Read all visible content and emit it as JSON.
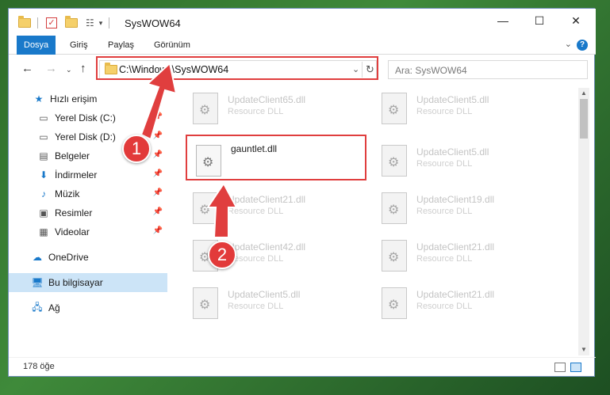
{
  "window": {
    "title": "SysWOW64",
    "minimize_glyph": "—",
    "maximize_glyph": "☐",
    "close_glyph": "✕"
  },
  "ribbon": {
    "tabs": [
      "Dosya",
      "Giriş",
      "Paylaş",
      "Görünüm"
    ],
    "help_glyph": "?"
  },
  "address": {
    "path": "C:\\Windows\\SysWOW64",
    "search_placeholder": "Ara: SysWOW64"
  },
  "sidebar": {
    "items": [
      {
        "label": "Hızlı erişim",
        "icon": "star-icon",
        "pinned": false
      },
      {
        "label": "Yerel Disk (C:)",
        "icon": "drive-icon",
        "pinned": true
      },
      {
        "label": "Yerel Disk (D:)",
        "icon": "drive-icon",
        "pinned": true
      },
      {
        "label": "Belgeler",
        "icon": "document-icon",
        "pinned": true
      },
      {
        "label": "İndirmeler",
        "icon": "download-icon",
        "pinned": true
      },
      {
        "label": "Müzik",
        "icon": "music-icon",
        "pinned": true
      },
      {
        "label": "Resimler",
        "icon": "picture-icon",
        "pinned": true
      },
      {
        "label": "Videolar",
        "icon": "video-icon",
        "pinned": true
      },
      {
        "label": "OneDrive",
        "icon": "cloud-icon",
        "pinned": false
      },
      {
        "label": "Bu bilgisayar",
        "icon": "computer-icon",
        "pinned": false
      },
      {
        "label": "Ağ",
        "icon": "network-icon",
        "pinned": false
      }
    ]
  },
  "files": [
    {
      "name": "UpdateClient65.dll",
      "type": "Resource DLL"
    },
    {
      "name": "UpdateClient5.dll",
      "type": "Resource DLL"
    },
    {
      "name": "gauntlet.dll",
      "type": ""
    },
    {
      "name": "UpdateClient5.dll",
      "type": "Resource DLL"
    },
    {
      "name": "UpdateClient21.dll",
      "type": "Resource DLL"
    },
    {
      "name": "UpdateClient19.dll",
      "type": "Resource DLL"
    },
    {
      "name": "UpdateClient42.dll",
      "type": "Resource DLL"
    },
    {
      "name": "UpdateClient21.dll",
      "type": "Resource DLL"
    },
    {
      "name": "UpdateClient5.dll",
      "type": "Resource DLL"
    },
    {
      "name": "UpdateClient21.dll",
      "type": "Resource DLL"
    }
  ],
  "status": {
    "count": "178 öğe"
  },
  "annotations": {
    "step1": "1",
    "step2": "2",
    "color": "#e03e3e"
  }
}
